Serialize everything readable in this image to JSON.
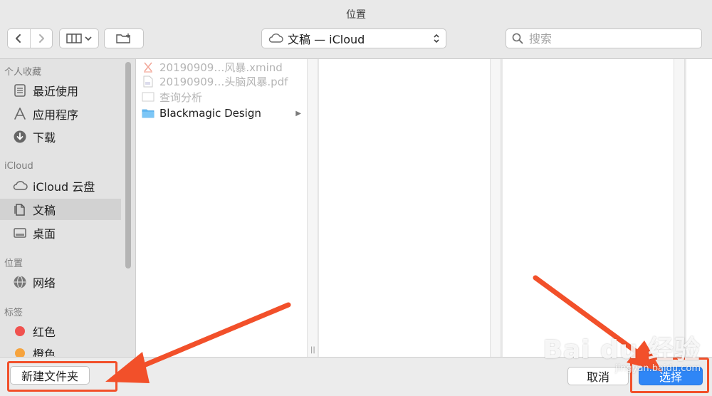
{
  "window": {
    "title": "位置"
  },
  "toolbar": {
    "back_icon": "chevron-left-icon",
    "forward_icon": "chevron-right-icon",
    "view_icon": "column-view-icon",
    "new_folder_icon": "new-folder-icon",
    "location_label": "文稿 — iCloud",
    "search_placeholder": "搜索"
  },
  "sidebar": {
    "favorites_header": "个人收藏",
    "favorites": [
      {
        "label": "最近使用",
        "icon": "recents-icon"
      },
      {
        "label": "应用程序",
        "icon": "applications-icon"
      },
      {
        "label": "下载",
        "icon": "downloads-icon"
      }
    ],
    "icloud_header": "iCloud",
    "icloud": [
      {
        "label": "iCloud 云盘",
        "icon": "cloud-icon"
      },
      {
        "label": "文稿",
        "icon": "documents-icon",
        "selected": true
      },
      {
        "label": "桌面",
        "icon": "desktop-icon"
      }
    ],
    "locations_header": "位置",
    "locations": [
      {
        "label": "网络",
        "icon": "network-icon"
      }
    ],
    "tags_header": "标签",
    "tags": [
      {
        "label": "红色",
        "color": "#f0524f"
      },
      {
        "label": "橙色",
        "color": "#f6a33d"
      }
    ]
  },
  "column1": {
    "items": [
      {
        "label": "20190909…风暴.xmind",
        "dim": true,
        "icon": "xmind-file-icon"
      },
      {
        "label": "20190909…头脑风暴.pdf",
        "dim": true,
        "icon": "pdf-file-icon"
      },
      {
        "label": "查询分析",
        "dim": true,
        "icon": "document-file-icon"
      },
      {
        "label": "Blackmagic Design",
        "dim": false,
        "icon": "folder-icon",
        "has_children": true
      }
    ]
  },
  "footer": {
    "new_folder_label": "新建文件夹",
    "cancel_label": "取消",
    "choose_label": "选择"
  },
  "annotation_colors": {
    "arrow": "#f2502a"
  },
  "watermark": {
    "brand": "Bai du 经验",
    "url": "jingyan.baidu.com"
  }
}
